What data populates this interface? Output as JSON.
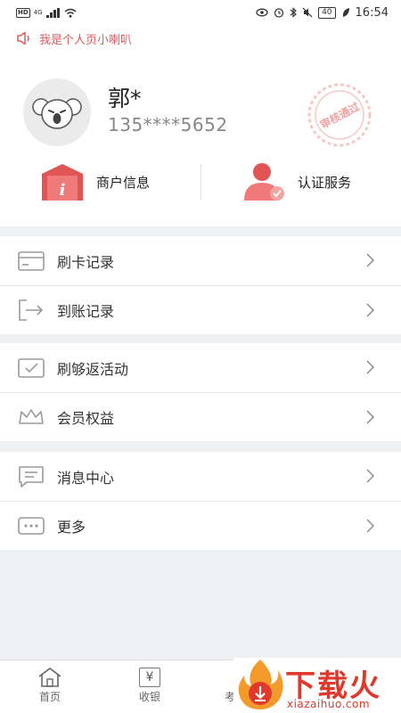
{
  "status_bar": {
    "hd": "HD",
    "signal": "4G",
    "battery": "40",
    "time": "16:54"
  },
  "notice": {
    "text": "我是个人页小喇叭"
  },
  "profile": {
    "name": "郭*",
    "phone": "135****5652",
    "stamp_text": "审核通过"
  },
  "quick_actions": [
    {
      "label": "商户信息"
    },
    {
      "label": "认证服务"
    }
  ],
  "menu_groups": [
    [
      {
        "label": "刷卡记录"
      },
      {
        "label": "到账记录"
      }
    ],
    [
      {
        "label": "刷够返活动"
      },
      {
        "label": "会员权益"
      }
    ],
    [
      {
        "label": "消息中心"
      },
      {
        "label": "更多"
      }
    ]
  ],
  "tabs": [
    {
      "label": "首页"
    },
    {
      "label": "收银"
    },
    {
      "label": "考"
    }
  ],
  "tab_icons": {
    "yen": "¥"
  },
  "watermark": {
    "title": "下载火",
    "url": "xiazaihuo.com"
  },
  "colors": {
    "accent": "#e45a5a",
    "background": "#eef0f4"
  }
}
